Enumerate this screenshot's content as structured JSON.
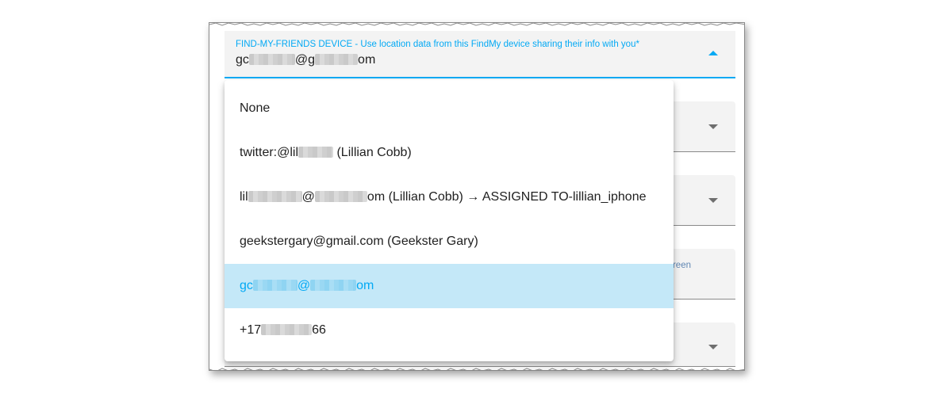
{
  "select": {
    "label": "FIND-MY-FRIENDS DEVICE - Use location data from this FindMy device sharing their info with you*",
    "value_start": "gc",
    "value_mid": "@g",
    "value_end": "om",
    "arrow_icon": "arrow-up-icon"
  },
  "background": {
    "hint_fragment": "reen"
  },
  "options": [
    {
      "parts": [
        "None"
      ]
    },
    {
      "parts": [
        "twitter:@lil",
        " (Lillian Cobb)"
      ]
    },
    {
      "parts": [
        "lil",
        "@",
        "om (Lillian Cobb) → ASSIGNED TO-lillian_iphone"
      ]
    },
    {
      "parts": [
        "geekstergary@gmail.com (Geekster Gary)"
      ]
    },
    {
      "parts": [
        "gc",
        "@",
        "om"
      ],
      "selected": true
    },
    {
      "parts": [
        "+17",
        "66"
      ]
    }
  ],
  "colors": {
    "accent": "#03a9f4",
    "selected_bg": "#c4e8f8"
  }
}
